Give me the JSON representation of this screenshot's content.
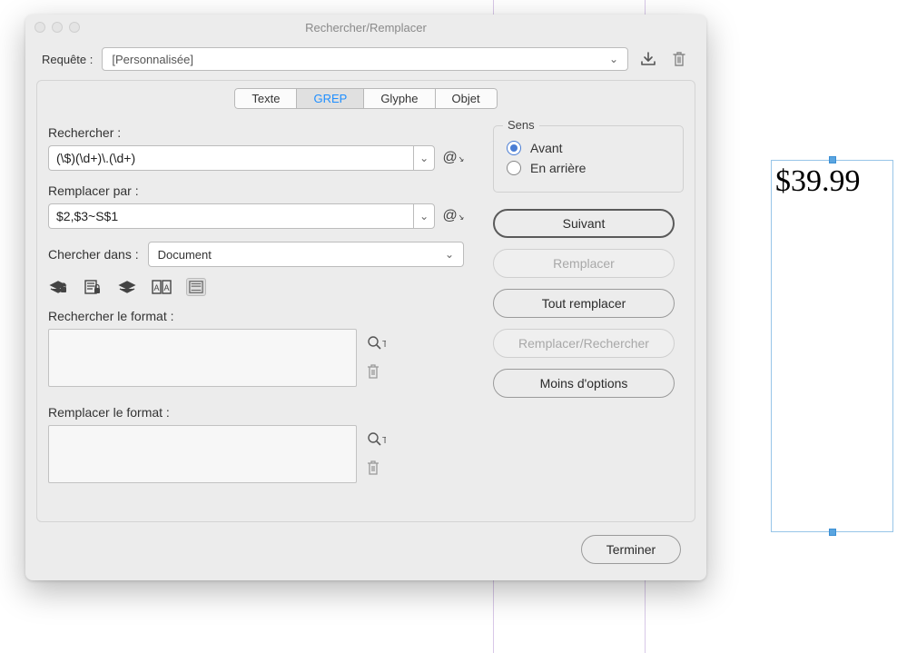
{
  "window": {
    "title": "Rechercher/Remplacer"
  },
  "query": {
    "label": "Requête :",
    "value": "[Personnalisée]"
  },
  "tabs": {
    "text": "Texte",
    "grep": "GREP",
    "glyph": "Glyphe",
    "object": "Objet"
  },
  "find": {
    "label": "Rechercher :",
    "value": "(\\$)(\\d+)\\.(\\d+)"
  },
  "replace": {
    "label": "Remplacer par :",
    "value": "$2,$3~S$1"
  },
  "searchIn": {
    "label": "Chercher dans :",
    "value": "Document"
  },
  "findFormat": {
    "label": "Rechercher le format :"
  },
  "replaceFormat": {
    "label": "Remplacer le format :"
  },
  "direction": {
    "legend": "Sens",
    "forward": "Avant",
    "backward": "En arrière"
  },
  "actions": {
    "next": "Suivant",
    "replace": "Remplacer",
    "replaceAll": "Tout remplacer",
    "replaceFind": "Remplacer/Rechercher",
    "fewerOptions": "Moins d'options",
    "done": "Terminer"
  },
  "document": {
    "price": "$39.99"
  },
  "icons": {
    "save": "download-icon",
    "delete": "trash-icon"
  }
}
